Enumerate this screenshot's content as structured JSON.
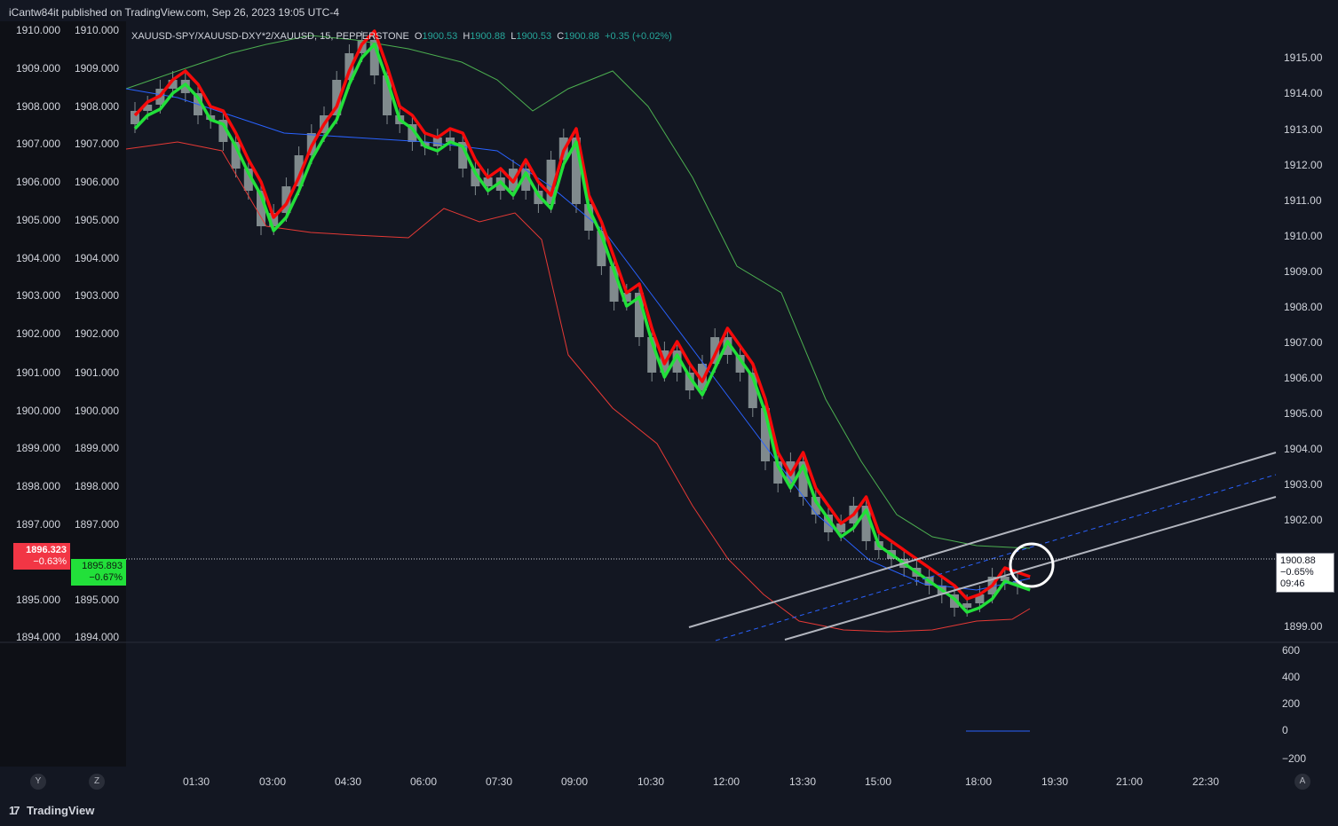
{
  "header": {
    "published": "iCantw84it published on TradingView.com, Sep 26, 2023 19:05 UTC-4"
  },
  "legend": {
    "symbol": "XAUUSD-SPY/XAUUSD-DXY*2/XAUUSD, 15, PEPPERSTONE",
    "o_key": "O",
    "o_val": "1900.53",
    "h_key": "H",
    "h_val": "1900.88",
    "l_key": "L",
    "l_val": "1900.53",
    "c_key": "C",
    "c_val": "1900.88",
    "change": "+0.35 (+0.02%)"
  },
  "tags": {
    "red_price": "1896.323",
    "red_pct": "−0.63%",
    "green_price": "1895.893",
    "green_pct": "−0.67%",
    "last_price": "1900.88",
    "last_pct": "−0.65%",
    "countdown": "09:46"
  },
  "colors": {
    "background": "#131722",
    "up_line": "#22e03a",
    "down_line": "#f50a0a",
    "candle": "#808a8d",
    "upper_band": "#4caf50",
    "lower_band": "#e53935",
    "ma": "#2962ff",
    "channel": "#b2b5be"
  },
  "axes": {
    "left_ticks": [
      "1910.000",
      "1909.000",
      "1908.000",
      "1907.000",
      "1906.000",
      "1905.000",
      "1904.000",
      "1903.000",
      "1902.000",
      "1901.000",
      "1900.000",
      "1899.000",
      "1898.000",
      "1897.000",
      "1895.000",
      "1894.000"
    ],
    "right_ticks": [
      "1915.00",
      "1914.00",
      "1913.00",
      "1912.00",
      "1911.00",
      "1910.00",
      "1909.00",
      "1908.00",
      "1907.00",
      "1906.00",
      "1905.00",
      "1904.00",
      "1903.00",
      "1902.00",
      "1899.00"
    ],
    "osc_ticks": [
      "600",
      "400",
      "200",
      "0",
      "−200"
    ],
    "time_ticks": [
      "01:30",
      "03:00",
      "04:30",
      "06:00",
      "07:30",
      "09:00",
      "10:30",
      "12:00",
      "13:30",
      "15:00",
      "18:00",
      "19:30",
      "21:00",
      "22:30"
    ]
  },
  "controls": {
    "y_btn": "Y",
    "z_btn": "Z",
    "a_btn": "A"
  },
  "brand": {
    "name": "TradingView",
    "logo": "17"
  },
  "chart_data": {
    "type": "candlestick",
    "interval": "15",
    "left_scale": [
      1894,
      1910
    ],
    "right_scale": [
      1899,
      1915
    ],
    "time_range": [
      "00:00",
      "23:45"
    ],
    "annotations": [
      "ascending parallel channel",
      "circle marker at last bar"
    ],
    "grid": false
  }
}
